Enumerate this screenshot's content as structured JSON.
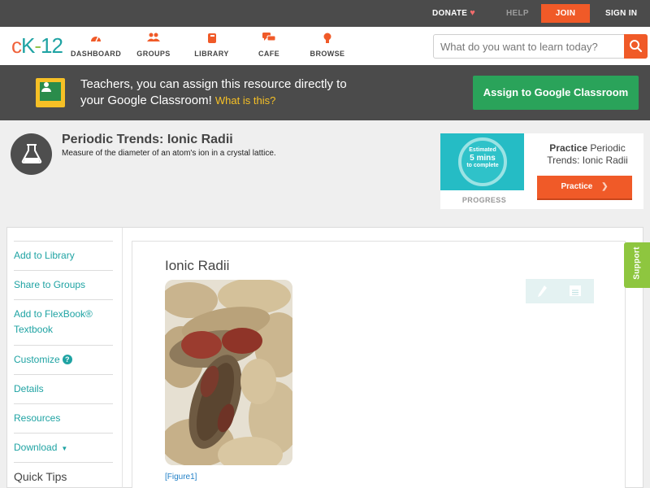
{
  "topbar": {
    "donate": "DONATE",
    "help": "HELP",
    "join": "JOIN",
    "sign_in": "SIGN IN"
  },
  "nav": {
    "logo": {
      "c": "c",
      "k": "K",
      "dash": "-",
      "num": "12"
    },
    "items": [
      {
        "label": "DASHBOARD",
        "icon": "speedometer-icon"
      },
      {
        "label": "GROUPS",
        "icon": "people-icon"
      },
      {
        "label": "LIBRARY",
        "icon": "book-icon"
      },
      {
        "label": "CAFE",
        "icon": "chat-bubbles-icon"
      },
      {
        "label": "BROWSE",
        "icon": "lightbulb-icon"
      }
    ],
    "search_placeholder": "What do you want to learn today?"
  },
  "banner": {
    "text": "Teachers, you can assign this resource directly to your Google Classroom!",
    "what_link": "What is this?",
    "assign_button": "Assign to Google Classroom"
  },
  "header": {
    "title": "Periodic Trends: Ionic Radii",
    "subtitle": "Measure of the diameter of an atom's ion in a crystal lattice."
  },
  "practice": {
    "estimate_line1": "Estimated",
    "estimate_line2": "5 mins",
    "estimate_line3": "to complete",
    "progress_label": "PROGRESS",
    "title_bold": "Practice",
    "title_rest": "Periodic Trends: Ionic Radii",
    "button": "Practice"
  },
  "sidebar": {
    "items": [
      {
        "label": "Add to Library"
      },
      {
        "label": "Share to Groups"
      },
      {
        "label": "Add to FlexBook® Textbook"
      },
      {
        "label": "Customize"
      },
      {
        "label": "Details"
      },
      {
        "label": "Resources"
      },
      {
        "label": "Download"
      },
      {
        "label": "Quick Tips"
      }
    ]
  },
  "article": {
    "title": "Ionic Radii",
    "figure_caption": "[Figure1]"
  },
  "support": "Support",
  "colors": {
    "accent_orange": "#f05a28",
    "teal": "#1fa3a3",
    "green": "#2aa35a",
    "support_green": "#8ec63f",
    "dark_bar": "#4b4b4b"
  }
}
